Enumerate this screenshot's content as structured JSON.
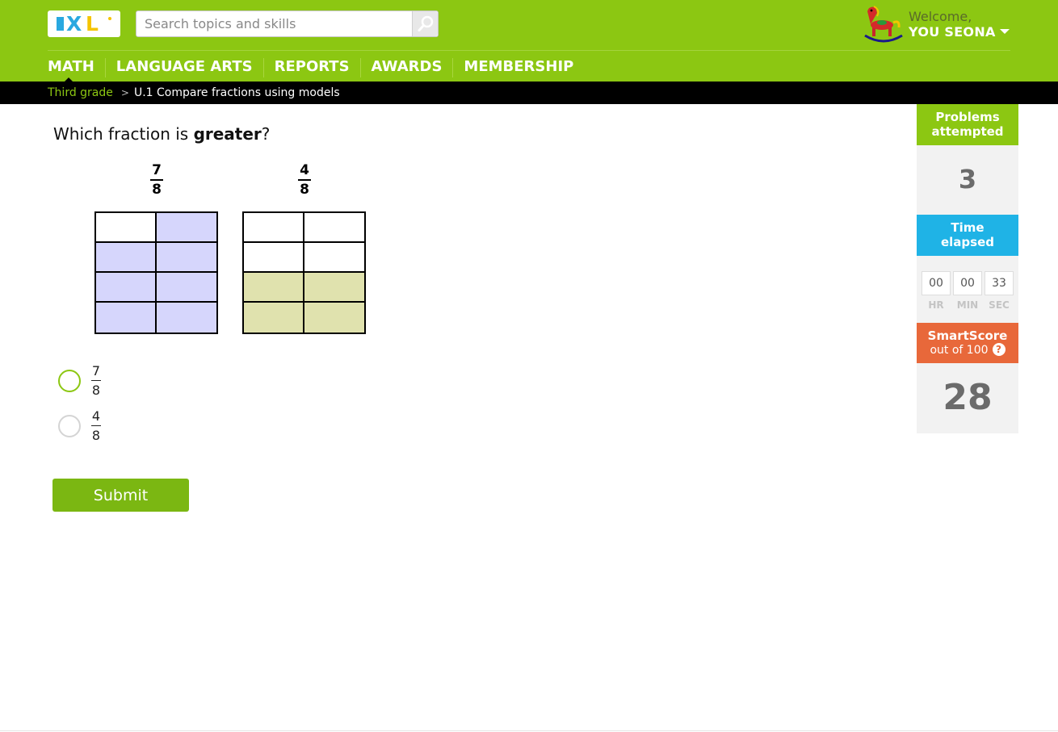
{
  "header": {
    "logo_text": "IXL",
    "search_placeholder": "Search topics and skills",
    "welcome": "Welcome,",
    "user_name": "YOU SEONA"
  },
  "nav": {
    "items": [
      "MATH",
      "LANGUAGE ARTS",
      "REPORTS",
      "AWARDS",
      "MEMBERSHIP"
    ],
    "active": "MATH"
  },
  "breadcrumb": {
    "parent": "Third grade",
    "separator": ">",
    "current": "U.1 Compare fractions using models"
  },
  "question": {
    "prefix": "Which fraction is ",
    "emphasis": "greater",
    "suffix": "?"
  },
  "models": [
    {
      "numerator": "7",
      "denominator": "8",
      "parts": 8,
      "shaded": 7,
      "shade_color": "#d6d6fc"
    },
    {
      "numerator": "4",
      "denominator": "8",
      "parts": 8,
      "shaded": 4,
      "shade_color": "#e0e2ae"
    }
  ],
  "options": [
    {
      "numerator": "7",
      "denominator": "8",
      "hovered": true
    },
    {
      "numerator": "4",
      "denominator": "8",
      "hovered": false
    }
  ],
  "submit_label": "Submit",
  "panel": {
    "problems_label_1": "Problems",
    "problems_label_2": "attempted",
    "problems_value": "3",
    "time_label_1": "Time",
    "time_label_2": "elapsed",
    "time": {
      "hr": "00",
      "min": "00",
      "sec": "33"
    },
    "time_units": {
      "hr": "HR",
      "min": "MIN",
      "sec": "SEC"
    },
    "smartscore_label": "SmartScore",
    "smartscore_sub": "out of 100",
    "help_glyph": "?",
    "smartscore_value": "28"
  },
  "colors": {
    "header_green": "#8cc712",
    "submit_green": "#7bb712",
    "problems_green": "#8cc712",
    "time_blue": "#1fb3e6",
    "smartscore_orange": "#e8683a"
  }
}
